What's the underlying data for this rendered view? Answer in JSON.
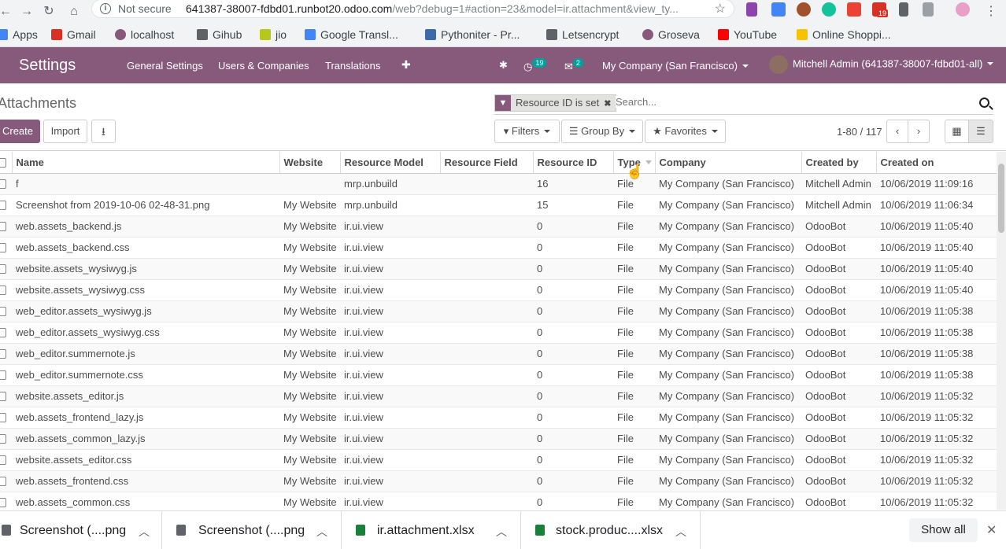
{
  "browser": {
    "security_label": "Not secure",
    "url_host": "641387-38007-fdbd01.runbot20.odoo.com",
    "url_path": "/web?debug=1#action=23&model=ir.attachment&view_ty...",
    "ext_badge": "19"
  },
  "bookmarks": [
    {
      "label": "Apps",
      "icon_color": "#4285f4"
    },
    {
      "label": "Gmail",
      "icon_color": "#d93025"
    },
    {
      "label": "localhost",
      "icon_color": "#875a7b"
    },
    {
      "label": "Gihub",
      "icon_color": "#5f6368"
    },
    {
      "label": "jio",
      "icon_color": "#b5c91a"
    },
    {
      "label": "Google Transl...",
      "icon_color": "#4285f4"
    },
    {
      "label": "Pythoniter - Pr...",
      "icon_color": "#3c6ca8"
    },
    {
      "label": "Letsencrypt",
      "icon_color": "#5f6368"
    },
    {
      "label": "Groseva",
      "icon_color": "#875a7b"
    },
    {
      "label": "YouTube",
      "icon_color": "#ff0000"
    },
    {
      "label": "Online Shoppi...",
      "icon_color": "#f9c200"
    }
  ],
  "navbar": {
    "app_name": "Settings",
    "menus": [
      "General Settings",
      "Users & Companies",
      "Translations"
    ],
    "plus": "✚",
    "activity_count": "19",
    "messages_count": "2",
    "company": "My Company (San Francisco)",
    "user": "Mitchell Admin (641387-38007-fdbd01-all)"
  },
  "control": {
    "breadcrumb": "Attachments",
    "facet_label": "Resource ID is set",
    "search_placeholder": "Search...",
    "create_label": "Create",
    "import_label": "Import",
    "filters_label": "Filters",
    "groupby_label": "Group By",
    "favorites_label": "Favorites",
    "pager": "1-80 / 117"
  },
  "table": {
    "columns": [
      "Name",
      "Website",
      "Resource Model",
      "Resource Field",
      "Resource ID",
      "Type",
      "Company",
      "Created by",
      "Created on"
    ],
    "rows": [
      [
        "f",
        "",
        "mrp.unbuild",
        "",
        "16",
        "File",
        "My Company (San Francisco)",
        "Mitchell Admin",
        "10/06/2019 11:09:16"
      ],
      [
        "Screenshot from 2019-10-06 02-48-31.png",
        "My Website",
        "mrp.unbuild",
        "",
        "15",
        "File",
        "My Company (San Francisco)",
        "Mitchell Admin",
        "10/06/2019 11:06:34"
      ],
      [
        "web.assets_backend.js",
        "My Website",
        "ir.ui.view",
        "",
        "0",
        "File",
        "My Company (San Francisco)",
        "OdooBot",
        "10/06/2019 11:05:40"
      ],
      [
        "web.assets_backend.css",
        "My Website",
        "ir.ui.view",
        "",
        "0",
        "File",
        "My Company (San Francisco)",
        "OdooBot",
        "10/06/2019 11:05:40"
      ],
      [
        "website.assets_wysiwyg.js",
        "My Website",
        "ir.ui.view",
        "",
        "0",
        "File",
        "My Company (San Francisco)",
        "OdooBot",
        "10/06/2019 11:05:40"
      ],
      [
        "website.assets_wysiwyg.css",
        "My Website",
        "ir.ui.view",
        "",
        "0",
        "File",
        "My Company (San Francisco)",
        "OdooBot",
        "10/06/2019 11:05:40"
      ],
      [
        "web_editor.assets_wysiwyg.js",
        "My Website",
        "ir.ui.view",
        "",
        "0",
        "File",
        "My Company (San Francisco)",
        "OdooBot",
        "10/06/2019 11:05:38"
      ],
      [
        "web_editor.assets_wysiwyg.css",
        "My Website",
        "ir.ui.view",
        "",
        "0",
        "File",
        "My Company (San Francisco)",
        "OdooBot",
        "10/06/2019 11:05:38"
      ],
      [
        "web_editor.summernote.js",
        "My Website",
        "ir.ui.view",
        "",
        "0",
        "File",
        "My Company (San Francisco)",
        "OdooBot",
        "10/06/2019 11:05:38"
      ],
      [
        "web_editor.summernote.css",
        "My Website",
        "ir.ui.view",
        "",
        "0",
        "File",
        "My Company (San Francisco)",
        "OdooBot",
        "10/06/2019 11:05:38"
      ],
      [
        "website.assets_editor.js",
        "My Website",
        "ir.ui.view",
        "",
        "0",
        "File",
        "My Company (San Francisco)",
        "OdooBot",
        "10/06/2019 11:05:32"
      ],
      [
        "web.assets_frontend_lazy.js",
        "My Website",
        "ir.ui.view",
        "",
        "0",
        "File",
        "My Company (San Francisco)",
        "OdooBot",
        "10/06/2019 11:05:32"
      ],
      [
        "web.assets_common_lazy.js",
        "My Website",
        "ir.ui.view",
        "",
        "0",
        "File",
        "My Company (San Francisco)",
        "OdooBot",
        "10/06/2019 11:05:32"
      ],
      [
        "website.assets_editor.css",
        "My Website",
        "ir.ui.view",
        "",
        "0",
        "File",
        "My Company (San Francisco)",
        "OdooBot",
        "10/06/2019 11:05:32"
      ],
      [
        "web.assets_frontend.css",
        "My Website",
        "ir.ui.view",
        "",
        "0",
        "File",
        "My Company (San Francisco)",
        "OdooBot",
        "10/06/2019 11:05:32"
      ],
      [
        "web.assets_common.css",
        "My Website",
        "ir.ui.view",
        "",
        "0",
        "File",
        "My Company (San Francisco)",
        "OdooBot",
        "10/06/2019 11:05:32"
      ]
    ]
  },
  "downloads": {
    "items": [
      {
        "name": "Screenshot (....png",
        "icon_color": "#5f6368"
      },
      {
        "name": "Screenshot (....png",
        "icon_color": "#5f6368"
      },
      {
        "name": "ir.attachment.xlsx",
        "icon_color": "#188038"
      },
      {
        "name": "stock.produc....xlsx",
        "icon_color": "#188038"
      }
    ],
    "show_all": "Show all"
  },
  "colors": {
    "brand": "#875a7b",
    "badge": "#00a09d"
  }
}
